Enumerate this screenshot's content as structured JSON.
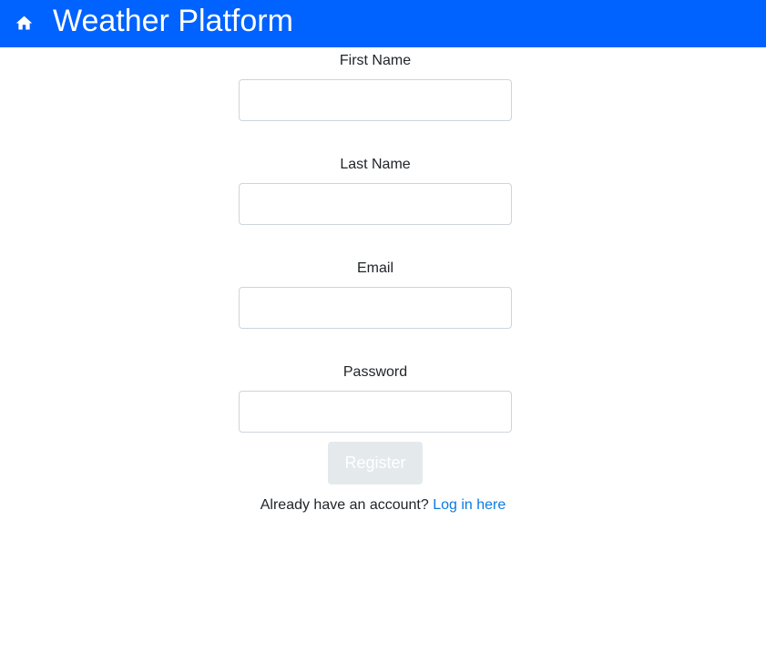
{
  "navbar": {
    "home_icon": "home-icon",
    "title": "Weather Platform",
    "background_color": "#0062ff"
  },
  "form": {
    "fields": [
      {
        "label": "First Name",
        "value": "",
        "placeholder": ""
      },
      {
        "label": "Last Name",
        "value": "",
        "placeholder": ""
      },
      {
        "label": "Email",
        "value": "",
        "placeholder": ""
      },
      {
        "label": "Password",
        "value": "",
        "placeholder": ""
      }
    ],
    "submit_label": "Register",
    "submit_disabled": true
  },
  "footer": {
    "prompt_text": "Already have an account?",
    "login_link_text": "Log in here",
    "link_color": "#0a7be0"
  }
}
